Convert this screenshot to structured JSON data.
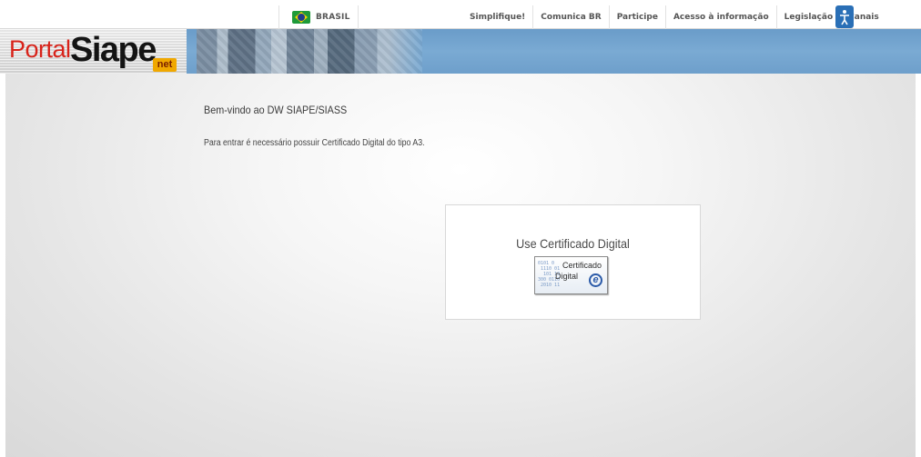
{
  "gov_bar": {
    "country_label": "BRASIL",
    "links": [
      "Simplifique!",
      "Comunica BR",
      "Participe",
      "Acesso à informação",
      "Legislação",
      "Canais"
    ]
  },
  "header": {
    "logo_portal": "Portal",
    "logo_siape": "Siape",
    "logo_net": "net"
  },
  "main": {
    "welcome": "Bem-vindo ao DW SIAPE/SIASS",
    "notice": "Para entrar é necessário possuir Certificado Digital do tipo A3.",
    "cert_panel": {
      "title": "Use Certificado Digital",
      "button_line1": "Certificado",
      "button_line2": "Digital",
      "button_emblem": "e"
    }
  },
  "colors": {
    "banner_blue": "#7aaad3",
    "logo_red": "#d8231a",
    "net_orange": "#f0a800"
  }
}
